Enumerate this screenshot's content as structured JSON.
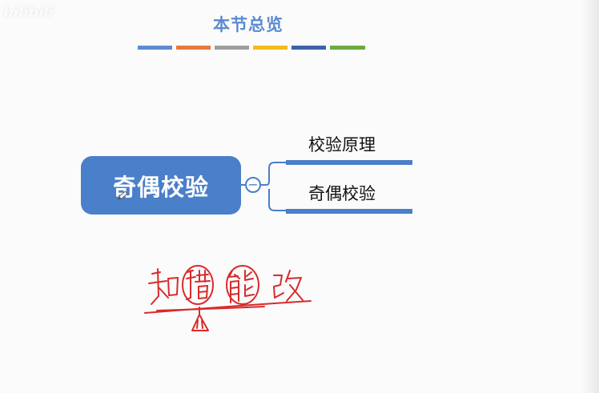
{
  "watermark": "bilibili",
  "slide": {
    "title": "本节总览",
    "color_bars": [
      "#5b8bd0",
      "#e57a3a",
      "#9e9e9e",
      "#f4b91e",
      "#3f62aa",
      "#6aaa43"
    ]
  },
  "mindmap": {
    "root_label": "奇偶校验",
    "collapse_symbol": "−",
    "branches": [
      {
        "label": "校验原理"
      },
      {
        "label": "奇偶校验"
      }
    ],
    "accent_color": "#4a7fc9"
  },
  "annotation": {
    "handwritten_text": "知错能改",
    "ink_color": "#d72b2b"
  }
}
